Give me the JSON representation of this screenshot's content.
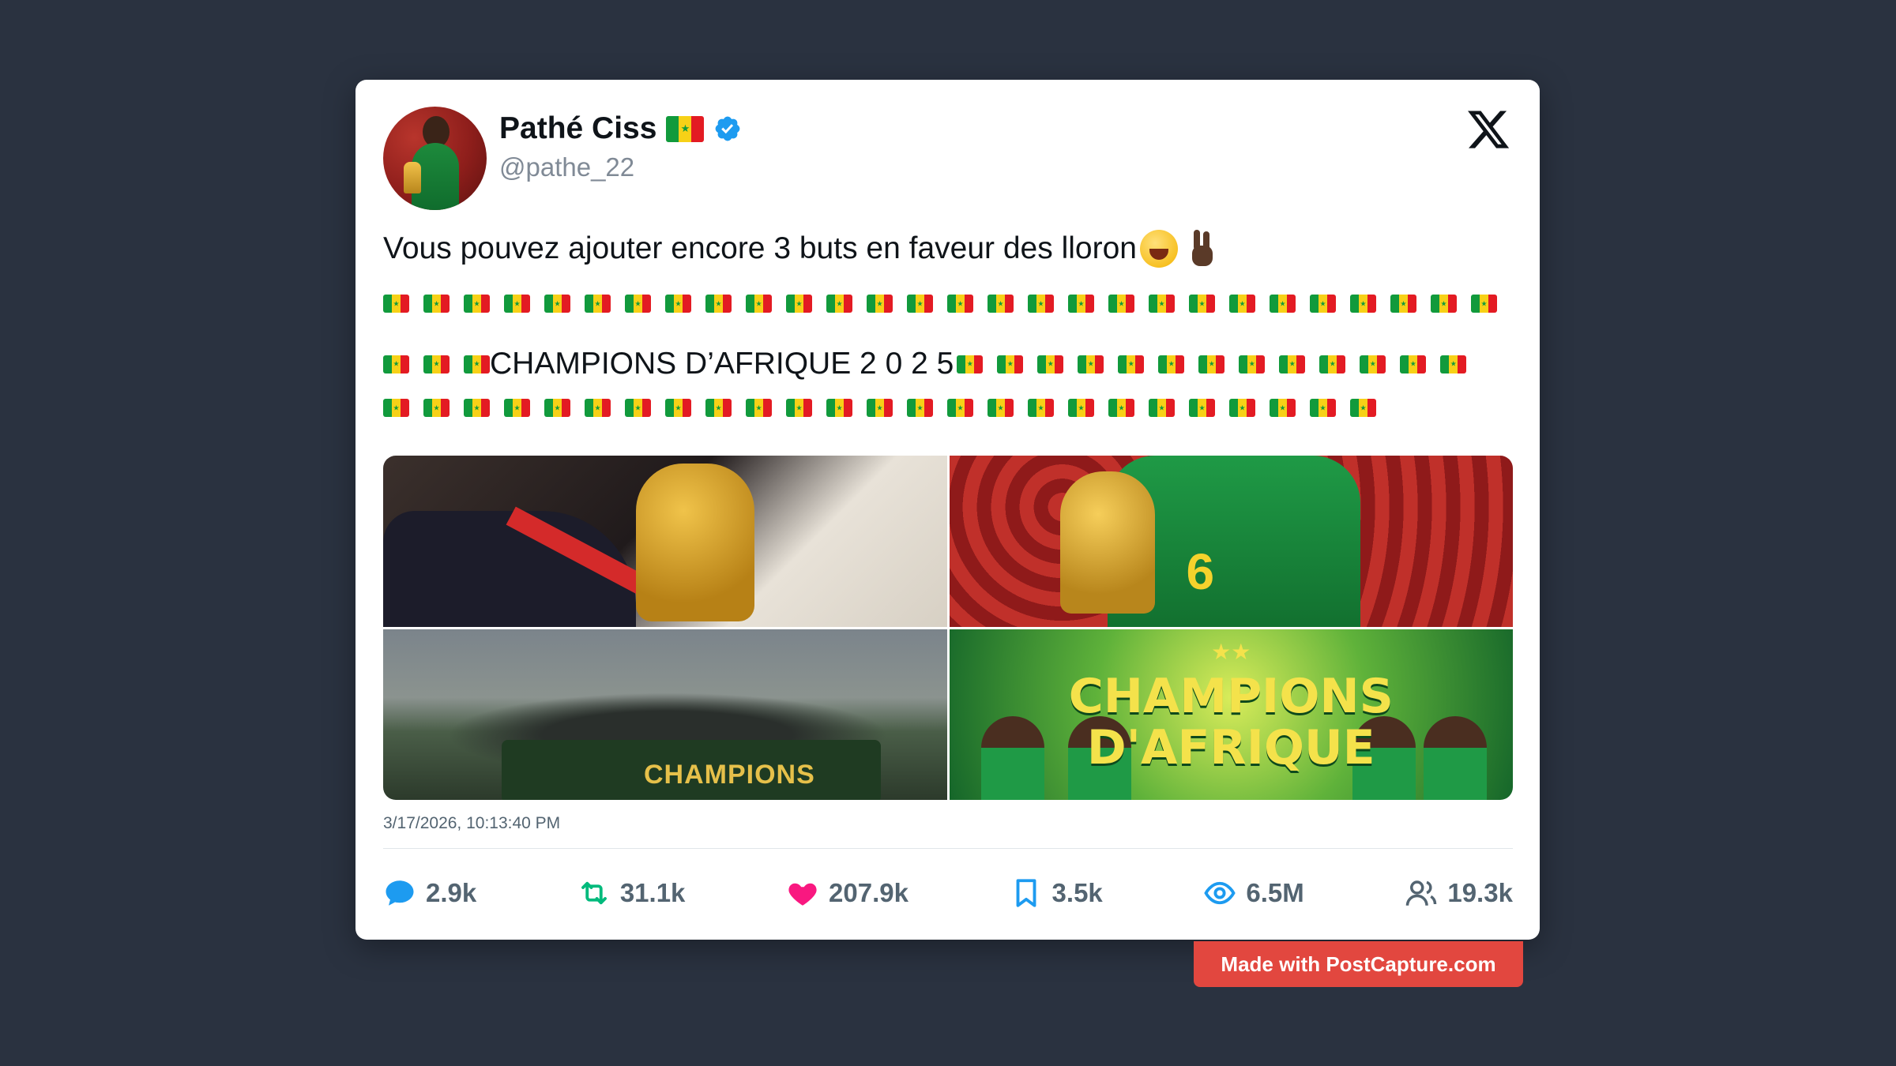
{
  "author": {
    "name": "Pathé Ciss",
    "handle": "@pathe_22",
    "verified": true
  },
  "tweet": {
    "line1": "Vous pouvez ajouter encore 3 buts en faveur des lloron",
    "line1_emojis": [
      "face-with-tears-of-joy",
      "victory-hand-dark-skin"
    ],
    "flag_emoji": "flag-senegal",
    "line2_flag_count": 28,
    "line3_flags_before": 3,
    "line3_text": "CHAMPIONS D’AFRIQUE 2 0 2 5",
    "line3_flags_after": 13,
    "line4_flag_count": 25
  },
  "media": [
    {
      "name": "photo-trophy-closeup",
      "text": ""
    },
    {
      "name": "photo-player-number-6-with-trophy",
      "text": "6"
    },
    {
      "name": "photo-victory-bus-parade",
      "text": "CHAMPIONS"
    },
    {
      "name": "photo-team-champions-poster",
      "text_top": "CHAMPIONS",
      "text_bottom": "D'AFRIQUE",
      "stars": "★★"
    }
  ],
  "timestamp": "3/17/2026, 10:13:40 PM",
  "stats": {
    "replies": "2.9k",
    "retweets": "31.1k",
    "likes": "207.9k",
    "bookmarks": "3.5k",
    "views": "6.5M",
    "followers": "19.3k"
  },
  "colors": {
    "background": "#2a3240",
    "reply": "#1d9bf0",
    "retweet": "#00ba7c",
    "like": "#f91880",
    "bookmark": "#1d9bf0",
    "views": "#1d9bf0",
    "badge": "#e2473f"
  },
  "watermark": "Made with PostCapture.com"
}
